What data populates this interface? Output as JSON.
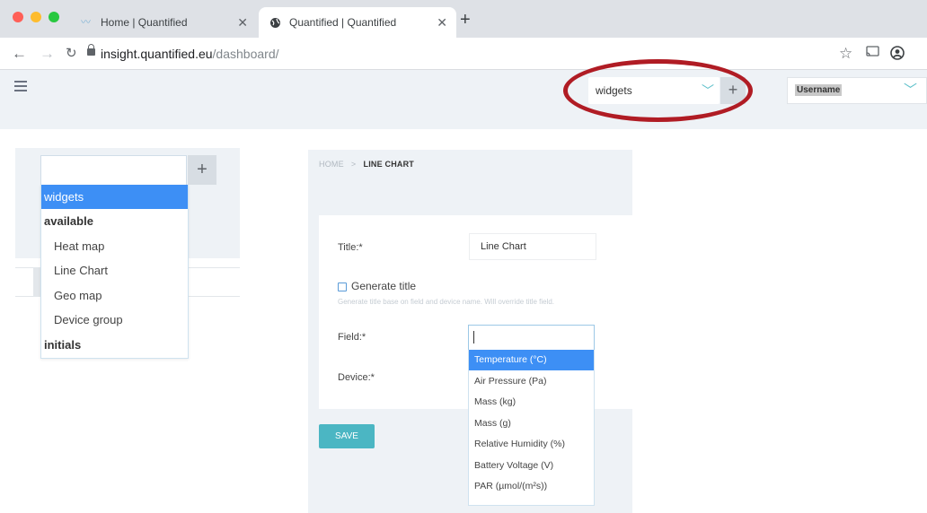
{
  "browser": {
    "tabs": [
      {
        "label": "Home | Quantified",
        "active": false,
        "icon": "quantified-logo-icon"
      },
      {
        "label": "Quantified | Quantified",
        "active": true,
        "icon": "globe-icon"
      }
    ],
    "url_host": "insight.quantified.eu",
    "url_path": "/dashboard/"
  },
  "header": {
    "dashboard_select_value": "widgets",
    "user_select_value": "Username"
  },
  "left_dropdown": {
    "selected": "widgets",
    "groups": [
      {
        "label": "available",
        "options": [
          "Heat map",
          "Line Chart",
          "Geo map",
          "Device group"
        ]
      },
      {
        "label": "initials",
        "options": []
      }
    ]
  },
  "breadcrumb": {
    "home": "HOME",
    "separator": ">",
    "current": "LINE CHART"
  },
  "form": {
    "title_label": "Title:*",
    "title_value": "Line Chart",
    "generate_title_label": "Generate title",
    "generate_title_help": "Generate title base on field and device name. Will override title field.",
    "field_label": "Field:*",
    "device_label": "Device:*",
    "field_options": [
      "Temperature (°C)",
      "Air Pressure (Pa)",
      "Mass (kg)",
      "Mass (g)",
      "Relative Humidity (%)",
      "Battery Voltage (V)",
      "PAR (µmol/(m²s))"
    ],
    "field_highlighted": "Temperature (°C)",
    "save_label": "SAVE"
  },
  "colors": {
    "accent_teal": "#4bb6c3",
    "selection_blue": "#3d8ff5",
    "annotation_red": "#b01c24"
  }
}
